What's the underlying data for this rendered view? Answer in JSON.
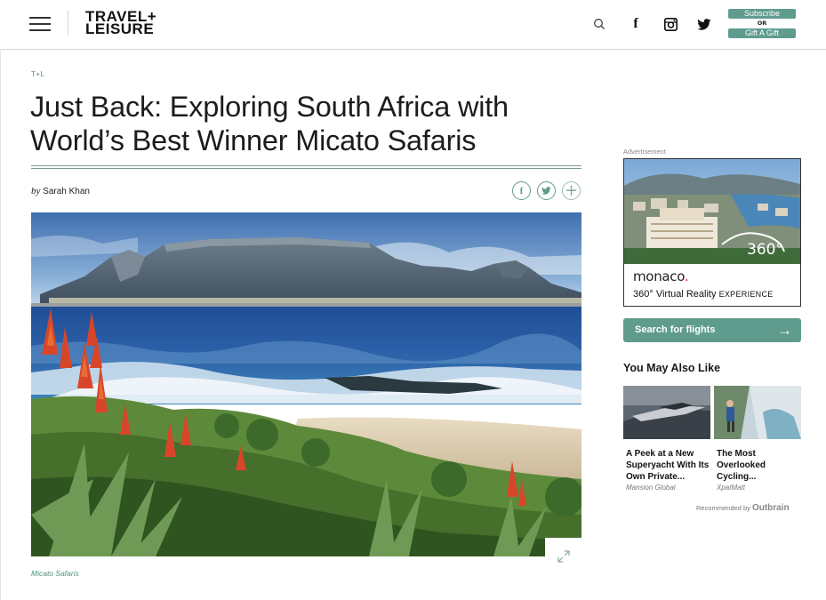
{
  "header": {
    "logo_line1": "TRAVEL+",
    "logo_line2": "LEISURE",
    "subscribe_label": "Subscribe",
    "or_label": "OR",
    "gift_label": "Gift A Gift",
    "icons": [
      "menu-icon",
      "search-icon",
      "facebook-icon",
      "instagram-icon",
      "twitter-icon"
    ]
  },
  "article": {
    "eyebrow": "T+L",
    "headline": "Just Back: Exploring South Africa with World’s Best Winner Micato Safaris",
    "byline_prefix": "by",
    "author": "Sarah Khan",
    "share_icons": [
      "facebook-icon",
      "twitter-icon",
      "plus-icon"
    ],
    "image_caption": "Micato Safaris"
  },
  "sidebar": {
    "ad_label": "Advertisement",
    "ad": {
      "brand_prefix": "mo",
      "brand_suffix": "naco",
      "brand_dot": ".",
      "badge": "360°",
      "tag_degree": "360°",
      "tag_text": "Virtual Reality",
      "tag_exp": "EXPERIENCE"
    },
    "search_flights_label": "Search for flights",
    "you_may_also_like": "You May Also Like",
    "recommendations": [
      {
        "title": "A Peek at a New Superyacht With Its Own Private...",
        "source": "Mansion Global"
      },
      {
        "title": "The Most Overlooked Cycling...",
        "source": "XpatMatt"
      }
    ],
    "recommended_by": "Recommended by",
    "recommender": "Outbrain"
  },
  "colors": {
    "accent": "#5f9c8e",
    "text": "#1c1c1c",
    "ad_dot": "#d62230"
  }
}
